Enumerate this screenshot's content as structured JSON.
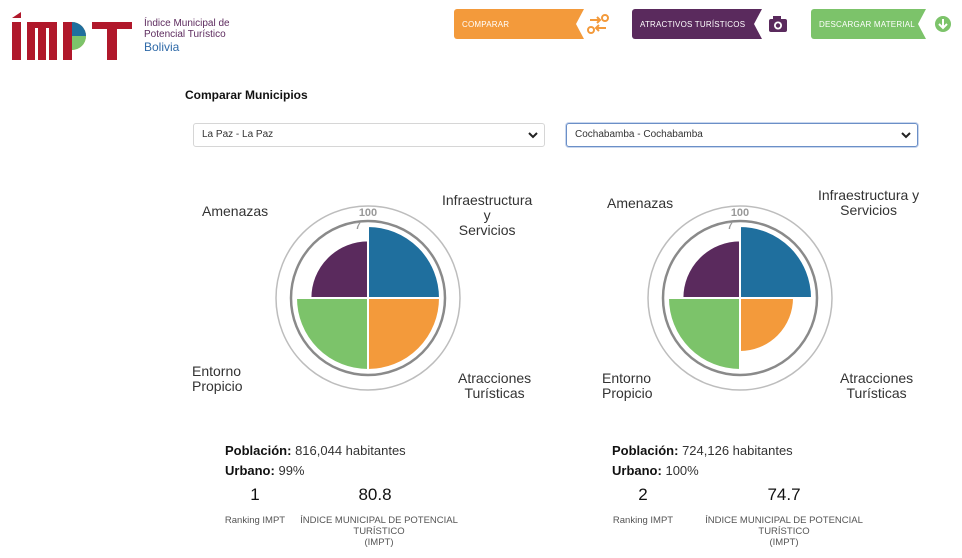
{
  "header": {
    "logo_line1": "Índice Municipal de",
    "logo_line2": "Potencial Turístico",
    "logo_line3": "Bolivia",
    "btn_comparar": "Comparar",
    "btn_atractivos": "Atractivos Turísticos",
    "btn_descargar": "Descargar Material"
  },
  "colors": {
    "orange": "#f39a3b",
    "purple": "#5a2a5d",
    "green": "#7cc36a",
    "blue": "#1f6f9e"
  },
  "section": {
    "title": "Comparar Municipios"
  },
  "selects": {
    "left_value": "La Paz - La Paz",
    "right_value": "Cochabamba - Cochabamba"
  },
  "chart_labels": {
    "amenazas": "Amenazas",
    "infra_l1": "Infraestructura y",
    "infra_l2": "Servicios",
    "entorno_l1": "Entorno",
    "entorno_l2": "Propicio",
    "atrac_l1": "Atracciones",
    "atrac_l2": "Turísticas",
    "ring_100": "100",
    "ring_7": "7"
  },
  "chart_data": [
    {
      "type": "polar-area",
      "municipio": "La Paz - La Paz",
      "categories": [
        "Infraestructura y Servicios",
        "Atracciones Turísticas",
        "Entorno Propicio",
        "Amenazas"
      ],
      "values": [
        100,
        100,
        100,
        80
      ],
      "max": 100
    },
    {
      "type": "polar-area",
      "municipio": "Cochabamba - Cochabamba",
      "categories": [
        "Infraestructura y Servicios",
        "Atracciones Turísticas",
        "Entorno Propicio",
        "Amenazas"
      ],
      "values": [
        100,
        75,
        100,
        80
      ],
      "max": 100
    }
  ],
  "left": {
    "poblacion_label": "Población:",
    "poblacion_value": "816,044 habitantes",
    "urbano_label": "Urbano:",
    "urbano_value": "99%",
    "ranking": "1",
    "ranking_caption": "Ranking IMPT",
    "indice": "80.8",
    "indice_cap1": "ÍNDICE MUNICIPAL DE POTENCIAL",
    "indice_cap2": "TURÍSTICO",
    "indice_cap3": "(IMPT)"
  },
  "right": {
    "poblacion_label": "Población:",
    "poblacion_value": "724,126 habitantes",
    "urbano_label": "Urbano:",
    "urbano_value": "100%",
    "ranking": "2",
    "ranking_caption": "Ranking IMPT",
    "indice": "74.7",
    "indice_cap1": "ÍNDICE MUNICIPAL DE POTENCIAL",
    "indice_cap2": "TURÍSTICO",
    "indice_cap3": "(IMPT)"
  }
}
